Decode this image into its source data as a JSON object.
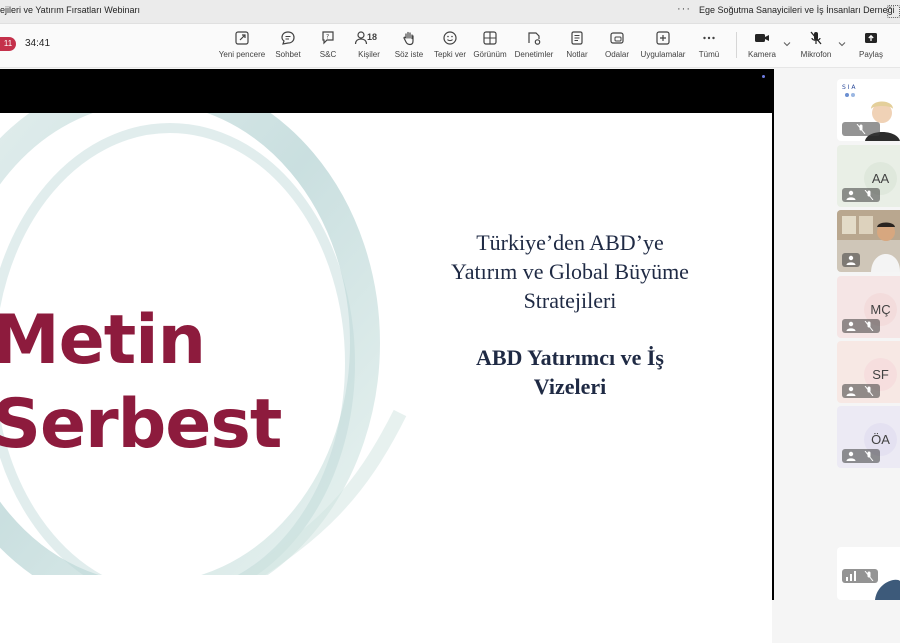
{
  "window": {
    "title": "ejileri ve Yatırım Fırsatları Webinarı",
    "more_label": "···",
    "organization": "Ege Soğutma Sanayicileri ve İş İnsanları Derneği"
  },
  "meeting": {
    "recording_badge": "11",
    "elapsed": "34:41"
  },
  "toolbar": {
    "new_window": "Yeni pencere",
    "chat": "Sohbet",
    "qa": "S&C",
    "people": "Kişiler",
    "people_count": "18",
    "raise_hand": "Söz iste",
    "react": "Tepki ver",
    "view": "Görünüm",
    "controls": "Denetimler",
    "notes": "Notlar",
    "rooms": "Odalar",
    "apps": "Uygulamalar",
    "more": "Tümü",
    "camera": "Kamera",
    "mic": "Mikrofon",
    "share": "Paylaş"
  },
  "slide": {
    "speaker_line1": "Metin",
    "speaker_line2": "Serbest",
    "title_line1": "Türkiye’den ABD’ye",
    "title_line2": "Yatırım ve Global Büyüme",
    "title_line3": "Stratejileri",
    "subtitle_line1": "ABD Yatırımcı ve İş",
    "subtitle_line2": "Vizeleri"
  },
  "participants": [
    {
      "initials": "",
      "kind": "video"
    },
    {
      "initials": "AA",
      "bg": "#dfe8dc"
    },
    {
      "initials": "",
      "kind": "video"
    },
    {
      "initials": "MÇ",
      "bg": "#f3dcdc"
    },
    {
      "initials": "SF",
      "bg": "#f6dede"
    },
    {
      "initials": "ÖA",
      "bg": "#e4e1f1"
    }
  ],
  "colors": {
    "speaker_name": "#8d1b3d",
    "slide_text": "#1f2a44",
    "recording": "#c4314b"
  }
}
